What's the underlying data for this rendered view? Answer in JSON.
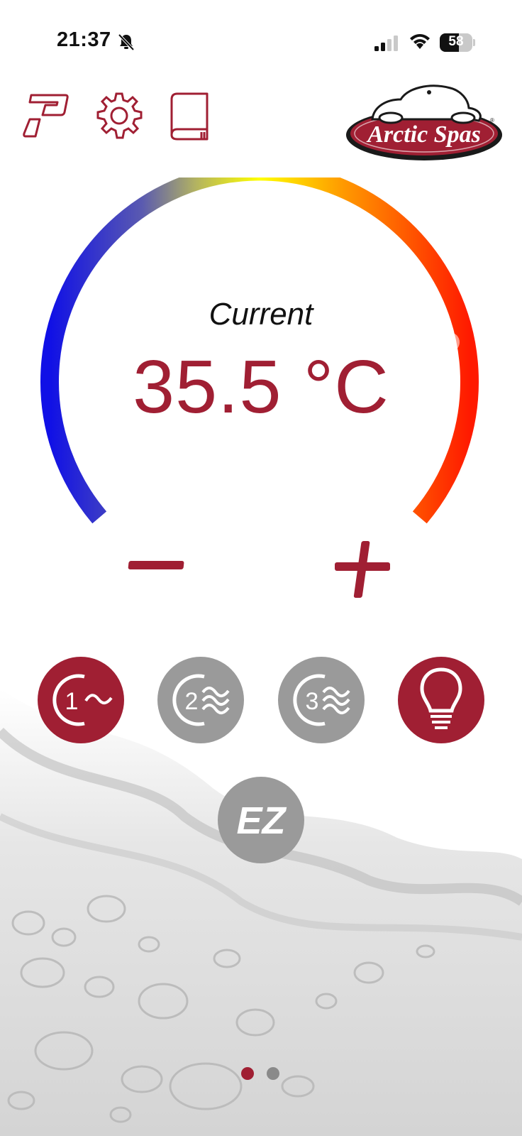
{
  "status_bar": {
    "time": "21:37",
    "battery_level": "58",
    "battery_fraction": 0.58,
    "icons": [
      "bell-mute-icon",
      "cellular-signal-icon",
      "wifi-icon",
      "battery-icon"
    ]
  },
  "toolbar": {
    "icons": [
      "p-logo-icon",
      "gear-icon",
      "book-icon"
    ]
  },
  "logo": {
    "text": "Arctic Spas"
  },
  "gauge": {
    "label": "Current",
    "temperature": "35.5 °C",
    "temperature_value": 35.5,
    "unit": "°C",
    "colors": [
      "#1010e6",
      "#ffff00",
      "#ff1a00"
    ]
  },
  "controls": {
    "minus": "–",
    "plus": "+",
    "pump1": {
      "number": "1",
      "active": true
    },
    "pump2": {
      "number": "2",
      "active": false
    },
    "pump3": {
      "number": "3",
      "active": false
    },
    "light": {
      "active": true
    },
    "ez": {
      "text": "EZ",
      "active": false
    }
  },
  "pager": {
    "pages": 2,
    "current": 1
  },
  "colors": {
    "accent": "#a01f33",
    "inactive": "#9a9a9a"
  }
}
